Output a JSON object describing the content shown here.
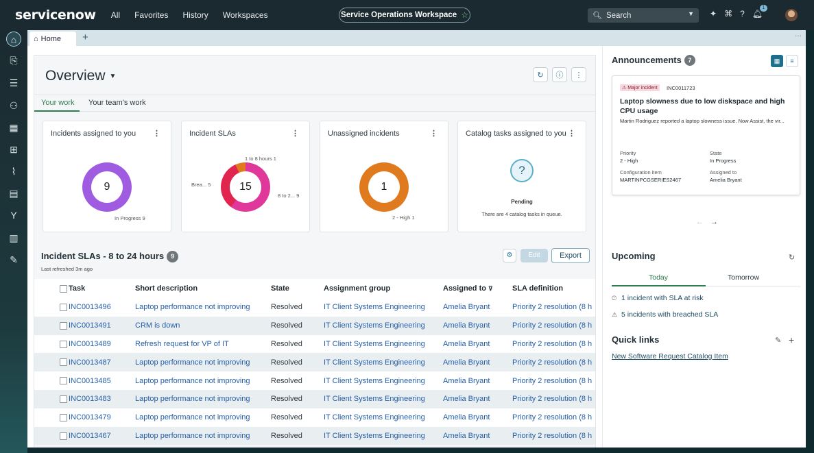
{
  "topbar": {
    "logo_text": "servicenow",
    "nav": [
      "All",
      "Favorites",
      "History",
      "Workspaces"
    ],
    "workspace_title": "Service Operations Workspace",
    "search_placeholder": "Search",
    "notification_count": "1"
  },
  "sidebar": {
    "icons": [
      "home-icon",
      "inbox-icon",
      "list-icon",
      "groups-icon",
      "calendar-icon",
      "grid-icon",
      "pulse-icon",
      "table-icon",
      "branch-icon",
      "analytics-icon",
      "wand-icon"
    ]
  },
  "tabs": {
    "home_label": "Home",
    "add_label": "+"
  },
  "overview": {
    "title": "Overview",
    "tabs": [
      "Your work",
      "Your team's work"
    ]
  },
  "cards": [
    {
      "title": "Incidents assigned to you",
      "center": "9",
      "labels": [
        "In Progress",
        "9"
      ]
    },
    {
      "title": "Incident SLAs",
      "center": "15",
      "labels": [
        "1 to 8 hours",
        "1",
        "Brea...",
        "5",
        "8 to 2...",
        "9"
      ]
    },
    {
      "title": "Unassigned incidents",
      "center": "1",
      "labels": [
        "2 - High",
        "1"
      ]
    },
    {
      "title": "Catalog tasks assigned to you",
      "status": "Pending",
      "message": "There are 4 catalog tasks in queue."
    }
  ],
  "sla_list": {
    "title": "Incident SLAs - 8 to 24 hours",
    "count": "9",
    "refreshed": "Last refreshed 3m ago",
    "edit_label": "Edit",
    "export_label": "Export",
    "columns": [
      "Task",
      "Short description",
      "State",
      "Assignment group",
      "Assigned to",
      "SLA definition"
    ],
    "rows": [
      [
        "INC0013496",
        "Laptop performance not improving",
        "Resolved",
        "IT Client Systems Engineering",
        "Amelia Bryant",
        "Priority 2 resolution (8 h"
      ],
      [
        "INC0013491",
        "CRM is down",
        "Resolved",
        "IT Client Systems Engineering",
        "Amelia Bryant",
        "Priority 2 resolution (8 h"
      ],
      [
        "INC0013489",
        "Refresh request for VP of IT",
        "Resolved",
        "IT Client Systems Engineering",
        "Amelia Bryant",
        "Priority 2 resolution (8 h"
      ],
      [
        "INC0013487",
        "Laptop performance not improving",
        "Resolved",
        "IT Client Systems Engineering",
        "Amelia Bryant",
        "Priority 2 resolution (8 h"
      ],
      [
        "INC0013485",
        "Laptop performance not improving",
        "Resolved",
        "IT Client Systems Engineering",
        "Amelia Bryant",
        "Priority 2 resolution (8 h"
      ],
      [
        "INC0013483",
        "Laptop performance not improving",
        "Resolved",
        "IT Client Systems Engineering",
        "Amelia Bryant",
        "Priority 2 resolution (8 h"
      ],
      [
        "INC0013479",
        "Laptop performance not improving",
        "Resolved",
        "IT Client Systems Engineering",
        "Amelia Bryant",
        "Priority 2 resolution (8 h"
      ],
      [
        "INC0013467",
        "Laptop performance not improving",
        "Resolved",
        "IT Client Systems Engineering",
        "Amelia Bryant",
        "Priority 2 resolution (8 h"
      ]
    ]
  },
  "announcements": {
    "title": "Announcements",
    "count": "7",
    "card": {
      "badge": "Major incident",
      "incident_id": "INC0011723",
      "headline": "Laptop slowness due to low diskspace and high CPU usage",
      "description": "Martin Rodriguez reported a laptop slowness issue. Now Assist, the vir...",
      "priority_label": "Priority",
      "priority_value": "2 - High",
      "state_label": "State",
      "state_value": "In Progress",
      "ci_label": "Configuration item",
      "ci_value": "MARTINPCGSERIES2467",
      "assigned_label": "Assigned to",
      "assigned_value": "Amelia Bryant"
    }
  },
  "upcoming": {
    "title": "Upcoming",
    "tabs": [
      "Today",
      "Tomorrow"
    ],
    "items": [
      "1 incident with SLA at risk",
      "5 incidents with breached SLA"
    ]
  },
  "quick_links": {
    "title": "Quick links",
    "link": "New Software Request Catalog Item"
  },
  "colors": {
    "accent_green": "#2e7d4e",
    "link_blue": "#245ea8",
    "donut_purple": "#a05ce0",
    "donut_orange": "#e07a1f",
    "donut_red": "#e0264f",
    "donut_pink": "#e0389a"
  }
}
